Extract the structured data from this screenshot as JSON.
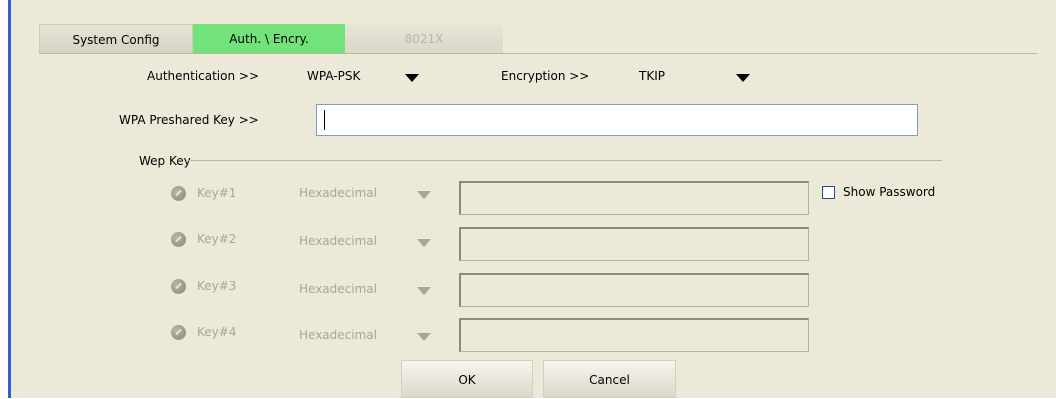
{
  "tabs": [
    {
      "label": "System Config",
      "state": "normal"
    },
    {
      "label": "Auth. \\ Encry.",
      "state": "active"
    },
    {
      "label": "8021X",
      "state": "disabled"
    }
  ],
  "auth": {
    "authentication_label": "Authentication >>",
    "authentication_value": "WPA-PSK",
    "encryption_label": "Encryption >>",
    "encryption_value": "TKIP"
  },
  "wpa": {
    "label": "WPA Preshared Key >>",
    "value": ""
  },
  "wep": {
    "group_label": "Wep Key",
    "keys": [
      {
        "label": "Key#1",
        "format": "Hexadecimal",
        "value": ""
      },
      {
        "label": "Key#2",
        "format": "Hexadecimal",
        "value": ""
      },
      {
        "label": "Key#3",
        "format": "Hexadecimal",
        "value": ""
      },
      {
        "label": "Key#4",
        "format": "Hexadecimal",
        "value": ""
      }
    ],
    "show_password_label": "Show Password",
    "show_password_checked": false
  },
  "buttons": {
    "ok": "OK",
    "cancel": "Cancel"
  },
  "colors": {
    "active_tab": "#72e27a",
    "panel_bg": "#ece9d8",
    "left_accent": "#2f5fd0"
  }
}
